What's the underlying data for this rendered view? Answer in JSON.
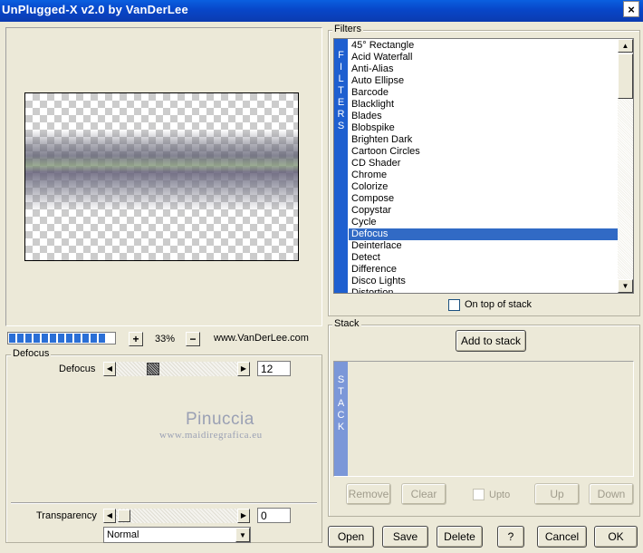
{
  "window": {
    "title": "UnPlugged-X v2.0 by VanDerLee",
    "close_label": "×"
  },
  "preview": {
    "zoom_minus": "−",
    "zoom_plus": "+",
    "zoom_value": "33%",
    "website": "www.VanDerLee.com",
    "progress_segments": 12
  },
  "filter_settings": {
    "group_title": "Defocus",
    "param_label": "Defocus",
    "param_value": "12",
    "param_fraction": 0.29
  },
  "watermark": {
    "name": "Pinuccia",
    "url": "www.maidiregrafica.eu"
  },
  "transparency": {
    "label": "Transparency",
    "value": "0",
    "blend_mode": "Normal"
  },
  "filters": {
    "group_title": "Filters",
    "strip_letters": "F\nI\nL\nT\nE\nR\nS",
    "items": [
      "45° Rectangle",
      "Acid Waterfall",
      "Anti-Alias",
      "Auto Ellipse",
      "Barcode",
      "Blacklight",
      "Blades",
      "Blobspike",
      "Brighten Dark",
      "Cartoon Circles",
      "CD Shader",
      "Chrome",
      "Colorize",
      "Compose",
      "Copystar",
      "Cycle",
      "Defocus",
      "Deinterlace",
      "Detect",
      "Difference",
      "Disco Lights",
      "Distortion"
    ],
    "selected_index": 16,
    "on_top_label": "On top of stack"
  },
  "stack": {
    "group_title": "Stack",
    "add_label": "Add to stack",
    "strip_letters": "S\nT\nA\nC\nK",
    "remove_label": "Remove",
    "clear_label": "Clear",
    "upto_label": "Upto",
    "up_label": "Up",
    "down_label": "Down"
  },
  "footer": {
    "open_label": "Open",
    "save_label": "Save",
    "delete_label": "Delete",
    "help_label": "?",
    "cancel_label": "Cancel",
    "ok_label": "OK"
  },
  "colors": {
    "titlebar": "#0846c8",
    "filter_strip": "#1e5fd0",
    "selection": "#316ac5",
    "stack_strip": "#7b97d8"
  }
}
